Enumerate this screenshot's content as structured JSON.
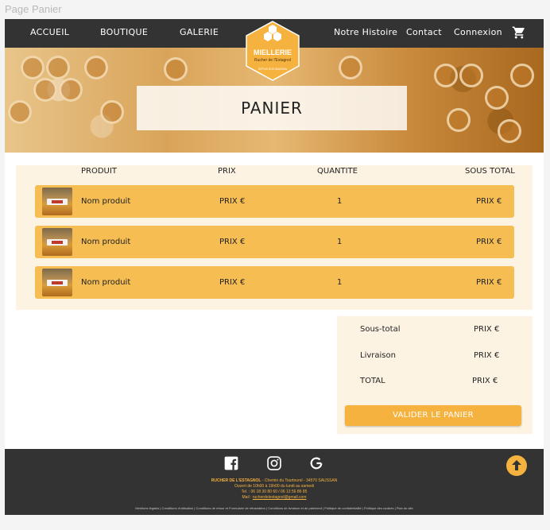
{
  "page_label": "Page Panier",
  "nav": {
    "left": [
      "ACCUEIL",
      "BOUTIQUE",
      "GALERIE"
    ],
    "right": [
      "Notre Histoire",
      "Contact",
      "Connexion"
    ],
    "cart_icon": "shopping-cart-icon"
  },
  "logo": {
    "name": "MIELLERIE",
    "sub": "Rucher de l'Estagnol",
    "tag": "DEPUIS 2019 SAUSSAN"
  },
  "hero": {
    "title": "PANIER"
  },
  "cart": {
    "headers": {
      "product": "PRODUIT",
      "price": "PRIX",
      "quantity": "QUANTITE",
      "subtotal": "SOUS TOTAL"
    },
    "rows": [
      {
        "name": "Nom produit",
        "price": "PRIX €",
        "qty": "1",
        "subtotal": "PRIX €"
      },
      {
        "name": "Nom produit",
        "price": "PRIX €",
        "qty": "1",
        "subtotal": "PRIX €"
      },
      {
        "name": "Nom produit",
        "price": "PRIX €",
        "qty": "1",
        "subtotal": "PRIX €"
      }
    ]
  },
  "totals": {
    "subtotal_label": "Sous-total",
    "subtotal_value": "PRIX €",
    "shipping_label": "Livraison",
    "shipping_value": "PRIX €",
    "total_label": "TOTAL",
    "total_value": "PRIX €",
    "validate_label": "VALIDER LE PANIER"
  },
  "footer": {
    "line1_strong": "RUCHER DE L'ESTAGNOL",
    "line1_rest": " - Chemin du Tourtourel - 34570 SAUSSAN",
    "line2": "Ouvert de 10h00 à 19h00 du lundi au samedi",
    "line3": "Tel. : 06 18 30 80 60 / 06 13 56 86 85",
    "line4_prefix": "Mail : ",
    "line4_mail": "rucherdelestagnol@gmail.com",
    "legal": "Mentions légales | Conditions d'utilisation | Conditions de retour et Formulaire de rétractation | Conditions de livraison et de paiement | Politique de confidentialité | Politique des cookies | Plan du site",
    "icons": [
      "facebook-icon",
      "instagram-icon",
      "google-icon",
      "back-to-top-icon"
    ]
  },
  "colors": {
    "nav_bg": "#333333",
    "accent": "#f6b23e",
    "row_bg": "#f6bd53",
    "panel_bg": "#fdf3e3"
  }
}
